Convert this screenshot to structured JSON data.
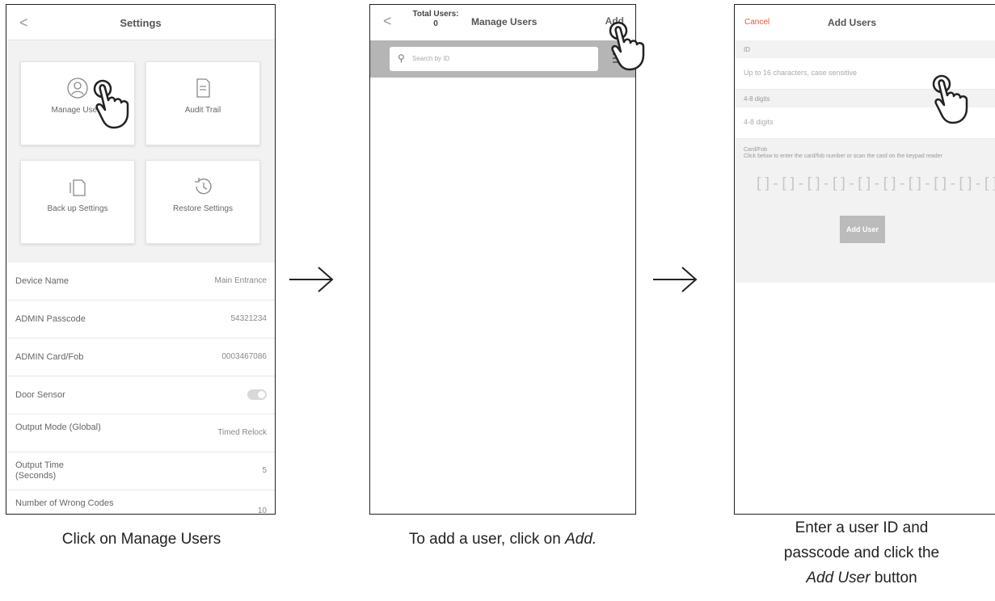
{
  "screen1": {
    "title": "Settings",
    "back": "<",
    "cards": [
      "Manage Users",
      "Audit Trail",
      "Back up Settings",
      "Restore Settings"
    ],
    "rows": [
      {
        "label": "Device Name",
        "value": "Main Entrance"
      },
      {
        "label": "ADMIN Passcode",
        "value": "54321234"
      },
      {
        "label": "ADMIN Card/Fob",
        "value": "0003467086"
      },
      {
        "label": "Door Sensor",
        "value": ""
      },
      {
        "label": "Output Mode (Global)",
        "value": "Timed Relock"
      },
      {
        "label": "Output Time (Seconds)",
        "value": "5"
      },
      {
        "label": "Number of Wrong Codes",
        "value": "10"
      }
    ]
  },
  "screen2": {
    "back": "<",
    "total_label": "Total Users:",
    "total_value": "0",
    "title": "Manage Users",
    "add": "Add",
    "search_placeholder": "Search by ID"
  },
  "screen3": {
    "cancel": "Cancel",
    "title": "Add Users",
    "id_label": "ID",
    "id_placeholder": "Up to 16 characters, case sensitive",
    "pin_label": "4-8 digits",
    "pin_placeholder": "4-8 digits",
    "card_label": "Card/Fob",
    "card_hint": "Click below to enter the card/fob number or scan the card on the keypad reader",
    "card_segments": "[]-[]-[]-[]-[]-[]-[]-[]-[]-[]",
    "add_button": "Add User"
  },
  "captions": {
    "c1": "Click on Manage Users",
    "c2_pre": "To add a user, click on ",
    "c2_em": "Add.",
    "c3_line1": "Enter a user ID and",
    "c3_line2": "passcode and click the",
    "c3_em": "Add User",
    "c3_post": " button"
  },
  "colors": {
    "accent_cancel": "#e8593a",
    "search_bar": "#b5b5b5",
    "grid_bg": "#f2f2f2"
  }
}
